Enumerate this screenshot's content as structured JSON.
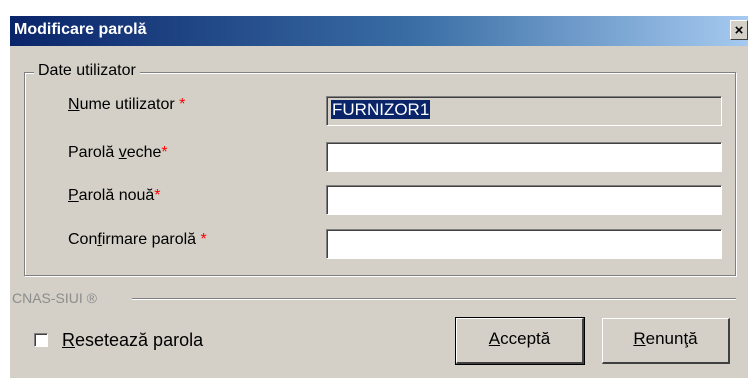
{
  "window": {
    "title": "Modificare parolă",
    "close_glyph": "×"
  },
  "group": {
    "legend": "Date utilizator"
  },
  "fields": [
    {
      "label_pre": "",
      "label_key": "N",
      "label_post": "ume utilizator ",
      "required": "*",
      "value": "FURNIZOR1",
      "readonly": true
    },
    {
      "label_pre": "Parolă ",
      "label_key": "v",
      "label_post": "eche",
      "required": "*",
      "value": "",
      "readonly": false
    },
    {
      "label_pre": "",
      "label_key": "P",
      "label_post": "arolă nouă",
      "required": "*",
      "value": "",
      "readonly": false
    },
    {
      "label_pre": "Con",
      "label_key": "f",
      "label_post": "irmare parolă ",
      "required": "*",
      "value": "",
      "readonly": false
    }
  ],
  "footer": {
    "brand": "CNAS-SIUI ®",
    "reset_pre": "",
    "reset_key": "R",
    "reset_post": "esetează parola",
    "reset_checked": false
  },
  "buttons": {
    "accept_key": "A",
    "accept_post": "cceptă",
    "cancel_key": "R",
    "cancel_post": "enunţă"
  },
  "colors": {
    "dialog_bg": "#d4d0c8",
    "title_start": "#0a246a",
    "title_end": "#a6caf0",
    "required": "#ff0000",
    "selection": "#0a246a"
  }
}
